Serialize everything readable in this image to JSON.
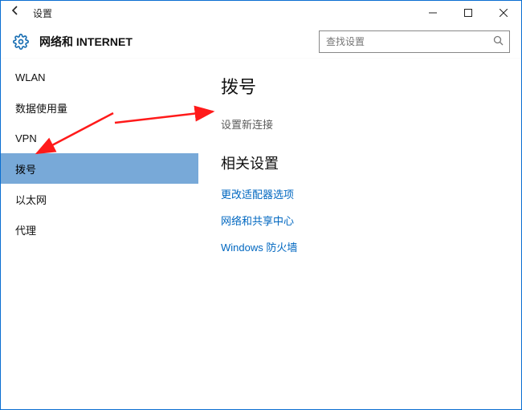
{
  "titlebar": {
    "title": "设置"
  },
  "header": {
    "category": "网络和 INTERNET",
    "search_placeholder": "查找设置"
  },
  "sidebar": {
    "items": [
      {
        "label": "WLAN",
        "selected": false
      },
      {
        "label": "数据使用量",
        "selected": false
      },
      {
        "label": "VPN",
        "selected": false
      },
      {
        "label": "拨号",
        "selected": true
      },
      {
        "label": "以太网",
        "selected": false
      },
      {
        "label": "代理",
        "selected": false
      }
    ]
  },
  "main": {
    "heading": "拨号",
    "new_connection": "设置新连接",
    "related_heading": "相关设置",
    "links": [
      "更改适配器选项",
      "网络和共享中心",
      "Windows 防火墙"
    ]
  }
}
